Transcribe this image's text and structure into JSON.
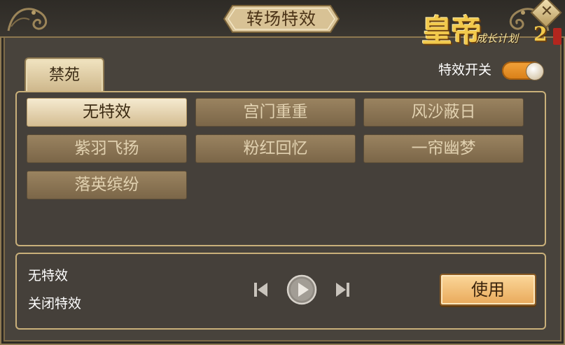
{
  "window": {
    "title": "转场特效",
    "close_icon": "close-icon"
  },
  "logo": {
    "main": "皇帝",
    "sub": "成长计划",
    "num": "2"
  },
  "tabs": [
    {
      "label": "禁苑",
      "active": true
    }
  ],
  "toggle": {
    "label": "特效开关",
    "on": true
  },
  "effects": [
    {
      "label": "无特效",
      "selected": true
    },
    {
      "label": "宫门重重",
      "selected": false
    },
    {
      "label": "风沙蔽日",
      "selected": false
    },
    {
      "label": "紫羽飞扬",
      "selected": false
    },
    {
      "label": "粉红回忆",
      "selected": false
    },
    {
      "label": "一帘幽梦",
      "selected": false
    },
    {
      "label": "落英缤纷",
      "selected": false
    }
  ],
  "status": {
    "current_effect": "无特效",
    "state_text": "关闭特效"
  },
  "controls": {
    "prev_icon": "previous-icon",
    "play_icon": "play-icon",
    "next_icon": "next-icon"
  },
  "use_button": {
    "label": "使用"
  },
  "colors": {
    "panel_border": "#c9b07a",
    "selected_bg": "#f5ead0",
    "unselected_bg": "#8d7655",
    "toggle_on": "#f2a33b",
    "use_button": "#f4c27f"
  }
}
